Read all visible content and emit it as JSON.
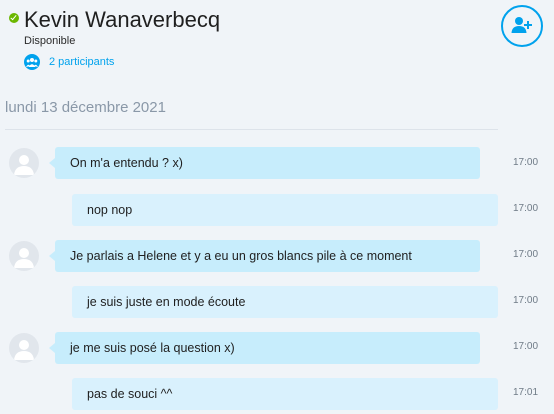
{
  "header": {
    "contact_name": "Kevin Wanaverbecq",
    "presence": "Disponible",
    "participants_label": "2 participants",
    "status_color": "#6bb700",
    "accent_color": "#00a2ed",
    "add_button_icon": "add-person-icon"
  },
  "conversation": {
    "date": "lundi 13 décembre 2021",
    "messages": [
      {
        "sender": "other",
        "text": "On m'a entendu ? x)",
        "time": "17:00"
      },
      {
        "sender": "me",
        "text": "nop nop",
        "time": "17:00"
      },
      {
        "sender": "other",
        "text": "Je parlais a Helene et y a eu un gros blancs pile à ce moment",
        "time": "17:00"
      },
      {
        "sender": "me",
        "text": "je suis juste en mode écoute",
        "time": "17:00"
      },
      {
        "sender": "other",
        "text": "je me suis posé la question x)",
        "time": "17:00"
      },
      {
        "sender": "me",
        "text": "pas de souci ^^",
        "time": "17:01"
      }
    ]
  }
}
